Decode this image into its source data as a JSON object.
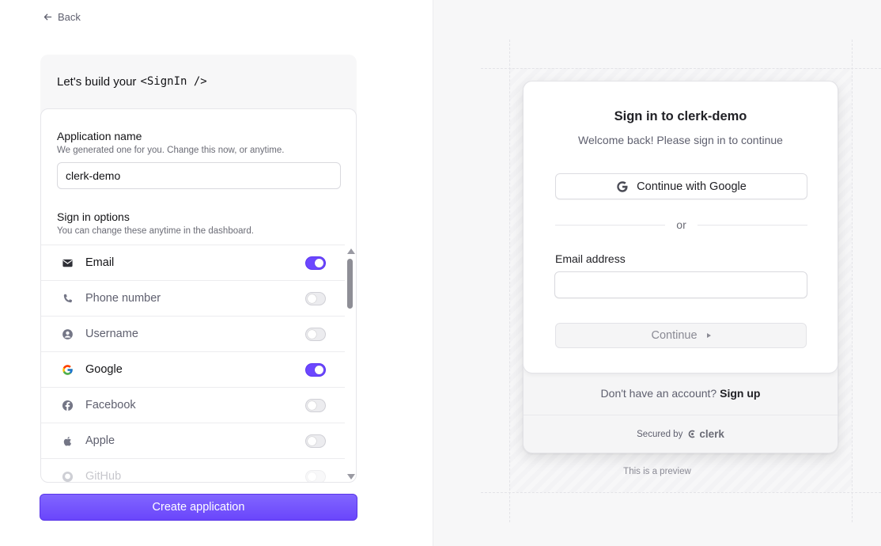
{
  "nav": {
    "back_label": "Back"
  },
  "builder": {
    "heading_prefix": "Let's build your",
    "heading_code": "<SignIn />",
    "app_name": {
      "title": "Application name",
      "subtitle": "We generated one for you. Change this now, or anytime.",
      "value": "clerk-demo"
    },
    "sign_in_options": {
      "title": "Sign in options",
      "subtitle": "You can change these anytime in the dashboard.",
      "items": [
        {
          "label": "Email",
          "icon": "mail-icon",
          "enabled": true
        },
        {
          "label": "Phone number",
          "icon": "phone-icon",
          "enabled": false
        },
        {
          "label": "Username",
          "icon": "user-circle-icon",
          "enabled": false
        },
        {
          "label": "Google",
          "icon": "google-icon",
          "enabled": true
        },
        {
          "label": "Facebook",
          "icon": "facebook-icon",
          "enabled": false
        },
        {
          "label": "Apple",
          "icon": "apple-icon",
          "enabled": false
        },
        {
          "label": "GitHub",
          "icon": "github-icon",
          "enabled": false
        }
      ]
    },
    "create_button": "Create application"
  },
  "preview": {
    "title": "Sign in to clerk-demo",
    "subtitle": "Welcome back! Please sign in to continue",
    "google_button": "Continue with Google",
    "divider": "or",
    "email_label": "Email address",
    "email_value": "",
    "continue_button": "Continue",
    "signup_prompt": "Don't have an account?",
    "signup_link": "Sign up",
    "secured_by": "Secured by",
    "brand": "clerk",
    "note": "This is a preview"
  },
  "colors": {
    "accent": "#6c47ff",
    "panel_bg": "#f7f7f8",
    "text": "#131316",
    "muted": "#5e5f6e"
  }
}
